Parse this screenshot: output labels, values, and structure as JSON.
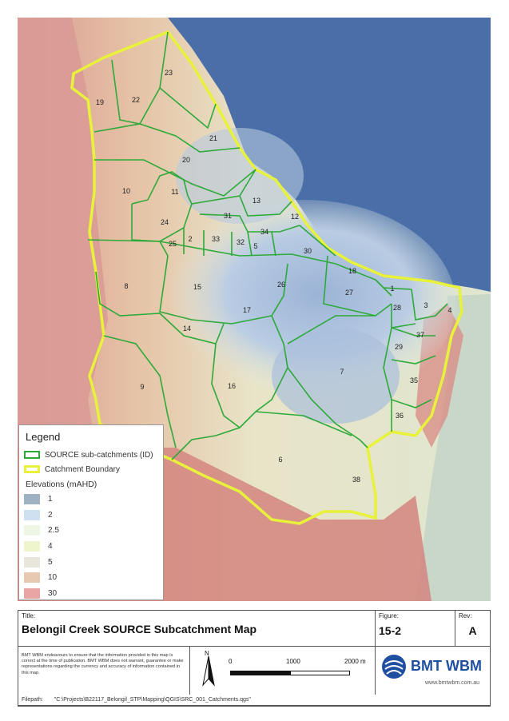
{
  "map": {
    "subcatchments": [
      {
        "id": "23"
      },
      {
        "id": "22"
      },
      {
        "id": "19"
      },
      {
        "id": "21"
      },
      {
        "id": "20"
      },
      {
        "id": "10"
      },
      {
        "id": "11"
      },
      {
        "id": "13"
      },
      {
        "id": "31"
      },
      {
        "id": "24"
      },
      {
        "id": "12"
      },
      {
        "id": "34"
      },
      {
        "id": "25"
      },
      {
        "id": "2"
      },
      {
        "id": "33"
      },
      {
        "id": "32"
      },
      {
        "id": "5"
      },
      {
        "id": "30"
      },
      {
        "id": "18"
      },
      {
        "id": "8"
      },
      {
        "id": "15"
      },
      {
        "id": "26"
      },
      {
        "id": "1"
      },
      {
        "id": "27"
      },
      {
        "id": "28"
      },
      {
        "id": "3"
      },
      {
        "id": "4"
      },
      {
        "id": "17"
      },
      {
        "id": "14"
      },
      {
        "id": "37"
      },
      {
        "id": "29"
      },
      {
        "id": "7"
      },
      {
        "id": "35"
      },
      {
        "id": "9"
      },
      {
        "id": "16"
      },
      {
        "id": "36"
      },
      {
        "id": "6"
      },
      {
        "id": "38"
      }
    ],
    "colors": {
      "subcatchment_line": "#2eaa3a",
      "boundary_line": "#e8f23a",
      "sea": "#4a6fa8"
    }
  },
  "legend": {
    "title": "Legend",
    "subcatchments_label": "SOURCE sub-catchments (ID)",
    "boundary_label": "Catchment Boundary",
    "elevations_title": "Elevations (mAHD)",
    "elevations": [
      {
        "label": "1",
        "color": "#9fb2c4"
      },
      {
        "label": "2",
        "color": "#cfe0f0"
      },
      {
        "label": "2.5",
        "color": "#eef6e4"
      },
      {
        "label": "4",
        "color": "#eef5cc"
      },
      {
        "label": "5",
        "color": "#e9e6dc"
      },
      {
        "label": "10",
        "color": "#e6c9b0"
      },
      {
        "label": "30",
        "color": "#e9a4a4"
      }
    ]
  },
  "titleblock": {
    "title_label": "Title:",
    "title": "Belongil Creek SOURCE Subcatchment Map",
    "figure_label": "Figure:",
    "figure": "15-2",
    "rev_label": "Rev:",
    "rev": "A",
    "disclaimer": "BMT WBM endeavours to ensure that the information provided in this map is correct at the time of publication. BMT WBM does not warrant, guarantee or make representations regarding the currency and accuracy of information contained in this map.",
    "north": "N",
    "scale_0": "0",
    "scale_1": "1000",
    "scale_2": "2000 m",
    "logo_main": "BMT WBM",
    "logo_url": "www.bmtwbm.com.au",
    "filepath_label": "Filepath:",
    "filepath": "\"C:\\Projects\\B22117_Belongil_STP\\Mapping\\QGIS\\SRC_001_Catchments.qgs\""
  }
}
